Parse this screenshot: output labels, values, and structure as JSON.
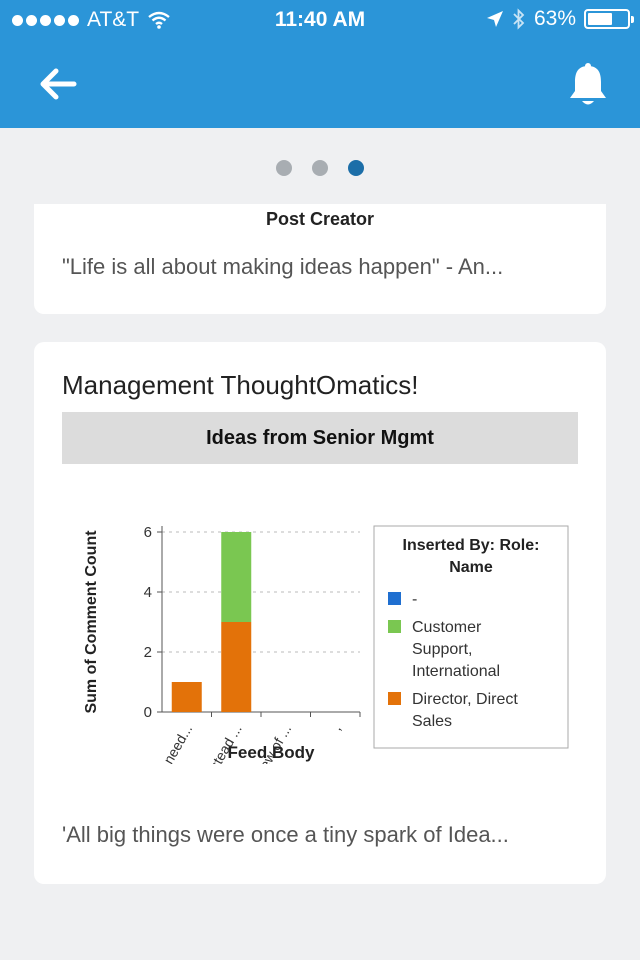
{
  "status_bar": {
    "carrier": "AT&T",
    "time": "11:40 AM",
    "battery": "63%",
    "battery_level": 0.63
  },
  "nav": {
    "back_icon": "back-arrow-icon",
    "bell_icon": "bell-icon",
    "accent": "#2b95d8"
  },
  "pager": {
    "count": 3,
    "active_index": 2
  },
  "card1": {
    "column_label": "Post Creator",
    "quote": "\"Life is all about making ideas happen\" - An..."
  },
  "card2": {
    "title": "Management ThoughtOmatics!",
    "footer": "'All big things were once a tiny spark of Idea..."
  },
  "chart_data": {
    "type": "bar",
    "stacked": true,
    "title": "Ideas from Senior Mgmt",
    "xlabel": "Feed Body",
    "ylabel": "Sum of Comment Count",
    "ylim": [
      0,
      6
    ],
    "yticks": [
      0,
      2,
      4,
      6
    ],
    "grid": true,
    "categories": [
      "We need...",
      "Instead ...",
      "A few of ...",
      ","
    ],
    "legend": {
      "title": "Inserted By: Role: Name",
      "placement": "right"
    },
    "series": [
      {
        "name": "-",
        "color": "#1f6fd0",
        "values": [
          0,
          0,
          0,
          0
        ]
      },
      {
        "name": "Director, Direct Sales",
        "color": "#e37209",
        "values": [
          1,
          3,
          0,
          0
        ]
      },
      {
        "name": "Customer Support, International",
        "color": "#7ac751",
        "values": [
          0,
          3,
          0,
          0
        ]
      }
    ],
    "legend_order": [
      "-",
      "Customer Support, International",
      "Director, Direct Sales"
    ]
  }
}
